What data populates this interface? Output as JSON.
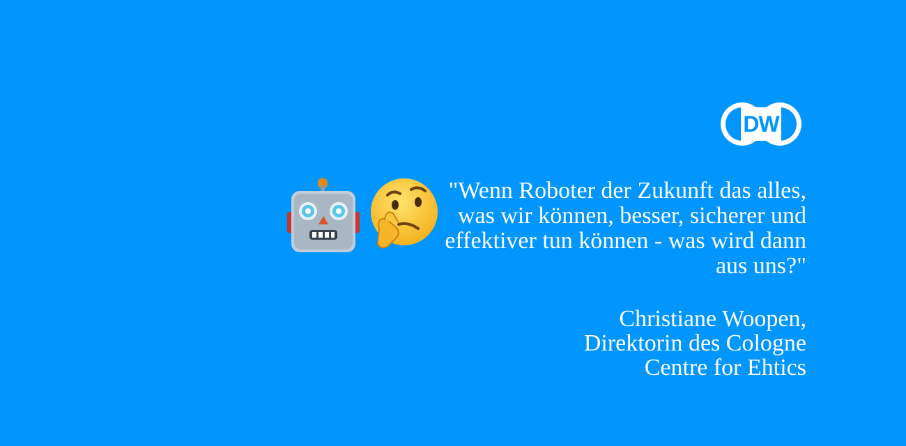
{
  "colors": {
    "background": "#0096fd",
    "text": "#ffffff"
  },
  "logo": {
    "text": "DW",
    "icon": "dw-logo"
  },
  "emojis": [
    "robot-face-icon",
    "thinking-face-icon"
  ],
  "quote": "\"Wenn Roboter der Zukunft das alles,\nwas wir können, besser, sicherer und\neffektiver tun können - was wird dann\naus uns?\"",
  "attribution": "Christiane Woopen,\nDirektorin des Cologne\nCentre for Ehtics"
}
